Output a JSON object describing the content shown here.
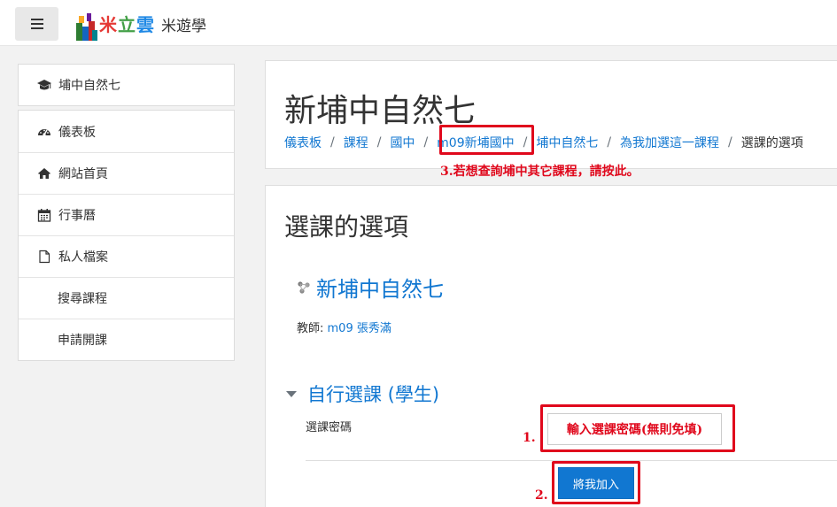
{
  "brand": {
    "name_colored": "米立雲",
    "name_plain": "米遊學"
  },
  "colors": {
    "accent": "#1177d1",
    "annotation": "#e0081c"
  },
  "sidebar": {
    "course_item": {
      "label": "埔中自然七",
      "icon": "graduation-cap-icon"
    },
    "items": [
      {
        "label": "儀表板",
        "icon": "dashboard-icon"
      },
      {
        "label": "網站首頁",
        "icon": "home-icon"
      },
      {
        "label": "行事曆",
        "icon": "calendar-icon"
      },
      {
        "label": "私人檔案",
        "icon": "file-icon"
      },
      {
        "label": "搜尋課程",
        "icon": ""
      },
      {
        "label": "申請開課",
        "icon": ""
      }
    ]
  },
  "header": {
    "title": "新埔中自然七",
    "breadcrumb": [
      "儀表板",
      "課程",
      "國中",
      "m09新埔國中",
      "埔中自然七",
      "為我加選這一課程",
      "選課的選項"
    ]
  },
  "annotations": {
    "note3": "3.若想查詢埔中其它課程，請按此。",
    "note1": "1.",
    "note2": "2."
  },
  "main": {
    "section_title": "選課的選項",
    "course_name": "新埔中自然七",
    "teacher_label": "教師: ",
    "teacher_name": "m09 張秀滿",
    "enrol_title": "自行選課 (學生)",
    "password_label": "選課密碼",
    "password_placeholder": "輸入選課密碼(無則免填)",
    "join_button": "將我加入"
  }
}
